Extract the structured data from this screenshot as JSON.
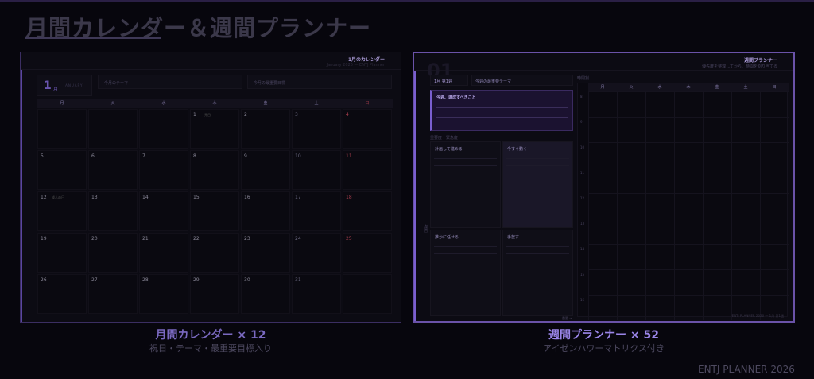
{
  "title": "月間カレンダー＆週間プランナー",
  "monthly": {
    "heading": "1月のカレンダー",
    "subheading": "January 2026 — ENTJ Planner",
    "month_num": "1",
    "month_kanji": "月",
    "month_en": "JANUARY",
    "theme_label": "今月のテーマ",
    "goal_label": "今月の最重要目標",
    "weekdays": [
      "月",
      "火",
      "水",
      "木",
      "金",
      "土",
      "日"
    ],
    "weeks": [
      [
        "",
        "",
        "",
        "1",
        "2",
        "3",
        "4"
      ],
      [
        "5",
        "6",
        "7",
        "8",
        "9",
        "10",
        "11"
      ],
      [
        "12",
        "13",
        "14",
        "15",
        "16",
        "17",
        "18"
      ],
      [
        "19",
        "20",
        "21",
        "22",
        "23",
        "24",
        "25"
      ],
      [
        "26",
        "27",
        "28",
        "29",
        "30",
        "31",
        ""
      ]
    ],
    "holidays": {
      "1": "元日",
      "12": "成人の日"
    },
    "caption": "月間カレンダー × 12",
    "caption_sub": "祝日・テーマ・最重要目標入り"
  },
  "weekly": {
    "heading": "週間プランナー",
    "subheading": "優先度を整理してから、時間を割り当てる",
    "big_number": "01",
    "week_label": "1月 第1週",
    "theme_label": "今週の最重要テーマ",
    "goal_label": "今週、達成すべきこと",
    "matrix_label": "重要度・緊急度",
    "quadrants": [
      "計画して進める",
      "今すぐ動く",
      "誰かに任せる",
      "手放す"
    ],
    "side_label": "1週目",
    "axis_label": "重要 →",
    "schedule_label": "時間割",
    "days": [
      "月",
      "火",
      "水",
      "木",
      "金",
      "土",
      "日"
    ],
    "hours": [
      "8",
      "9",
      "10",
      "11",
      "12",
      "13",
      "14",
      "15",
      "16"
    ],
    "footer": "ENTJ PLANNER 2026 — 1月 第1週",
    "caption": "週間プランナー × 52",
    "caption_sub": "アイゼンハワーマトリクス付き"
  },
  "footer": "ENTJ PLANNER 2026"
}
